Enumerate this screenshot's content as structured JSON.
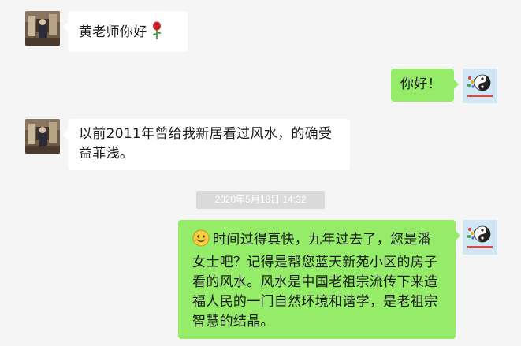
{
  "messages": [
    {
      "sender": "contact",
      "avatar": "photo-avatar",
      "text": "黄老师你好",
      "emoji": "rose-icon"
    },
    {
      "sender": "self",
      "avatar": "taiji-logo-avatar",
      "text": "你好！"
    },
    {
      "sender": "contact",
      "avatar": "photo-avatar",
      "text": "以前2011年曾给我新居看过风水，的确受益菲浅。"
    },
    {
      "sender": "self",
      "avatar": "taiji-logo-avatar",
      "emoji": "smiley-icon",
      "text": "时间过得真快，九年过去了，您是潘女士吧？记得是帮您蓝天新苑小区的房子看的风水。风水是中国老祖宗流传下来造福人民的一门自然环境和谐学，是老祖宗智慧的结晶。"
    }
  ],
  "timestamp": "2020年5月18日 14:32",
  "colors": {
    "background": "#f5f5f5",
    "incoming_bubble": "#ffffff",
    "outgoing_bubble": "#95ec69",
    "timestamp_pill": "#dadada"
  }
}
